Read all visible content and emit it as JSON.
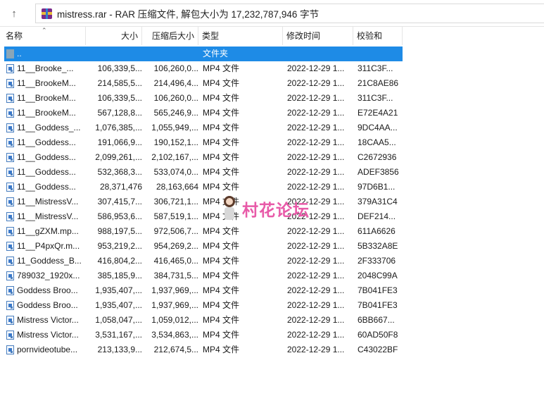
{
  "address_bar": {
    "path": "mistress.rar - RAR 压缩文件, 解包大小为 17,232,787,946 字节"
  },
  "columns": {
    "name": "名称",
    "size": "大小",
    "packed": "压缩后大小",
    "type": "类型",
    "modified": "修改时间",
    "crc": "校验和"
  },
  "parent_row": {
    "name": "..",
    "type": "文件夹"
  },
  "files": [
    {
      "name": "11__Brooke_...",
      "size": "106,339,5...",
      "packed": "106,260,0...",
      "type": "MP4 文件",
      "modified": "2022-12-29 1...",
      "crc": "311C3F..."
    },
    {
      "name": "11__BrookeM...",
      "size": "214,585,5...",
      "packed": "214,496,4...",
      "type": "MP4 文件",
      "modified": "2022-12-29 1...",
      "crc": "21C8AE86"
    },
    {
      "name": "11__BrookeM...",
      "size": "106,339,5...",
      "packed": "106,260,0...",
      "type": "MP4 文件",
      "modified": "2022-12-29 1...",
      "crc": "311C3F..."
    },
    {
      "name": "11__BrookeM...",
      "size": "567,128,8...",
      "packed": "565,246,9...",
      "type": "MP4 文件",
      "modified": "2022-12-29 1...",
      "crc": "E72E4A21"
    },
    {
      "name": "11__Goddess_...",
      "size": "1,076,385,...",
      "packed": "1,055,949,...",
      "type": "MP4 文件",
      "modified": "2022-12-29 1...",
      "crc": "9DC4AA..."
    },
    {
      "name": "11__Goddess...",
      "size": "191,066,9...",
      "packed": "190,152,1...",
      "type": "MP4 文件",
      "modified": "2022-12-29 1...",
      "crc": "18CAA5..."
    },
    {
      "name": "11__Goddess...",
      "size": "2,099,261,...",
      "packed": "2,102,167,...",
      "type": "MP4 文件",
      "modified": "2022-12-29 1...",
      "crc": "C2672936"
    },
    {
      "name": "11__Goddess...",
      "size": "532,368,3...",
      "packed": "533,074,0...",
      "type": "MP4 文件",
      "modified": "2022-12-29 1...",
      "crc": "ADEF3856"
    },
    {
      "name": "11__Goddess...",
      "size": "28,371,476",
      "packed": "28,163,664",
      "type": "MP4 文件",
      "modified": "2022-12-29 1...",
      "crc": "97D6B1..."
    },
    {
      "name": "11__MistressV...",
      "size": "307,415,7...",
      "packed": "306,721,1...",
      "type": "MP4 文件",
      "modified": "2022-12-29 1...",
      "crc": "379A31C4"
    },
    {
      "name": "11__MistressV...",
      "size": "586,953,6...",
      "packed": "587,519,1...",
      "type": "MP4 文件",
      "modified": "2022-12-29 1...",
      "crc": "DEF214..."
    },
    {
      "name": "11__gZXM.mp...",
      "size": "988,197,5...",
      "packed": "972,506,7...",
      "type": "MP4 文件",
      "modified": "2022-12-29 1...",
      "crc": "611A6626"
    },
    {
      "name": "11__P4pxQr.m...",
      "size": "953,219,2...",
      "packed": "954,269,2...",
      "type": "MP4 文件",
      "modified": "2022-12-29 1...",
      "crc": "5B332A8E"
    },
    {
      "name": "11_Goddess_B...",
      "size": "416,804,2...",
      "packed": "416,465,0...",
      "type": "MP4 文件",
      "modified": "2022-12-29 1...",
      "crc": "2F333706"
    },
    {
      "name": "789032_1920x...",
      "size": "385,185,9...",
      "packed": "384,731,5...",
      "type": "MP4 文件",
      "modified": "2022-12-29 1...",
      "crc": "2048C99A"
    },
    {
      "name": "Goddess Broo...",
      "size": "1,935,407,...",
      "packed": "1,937,969,...",
      "type": "MP4 文件",
      "modified": "2022-12-29 1...",
      "crc": "7B041FE3"
    },
    {
      "name": "Goddess Broo...",
      "size": "1,935,407,...",
      "packed": "1,937,969,...",
      "type": "MP4 文件",
      "modified": "2022-12-29 1...",
      "crc": "7B041FE3"
    },
    {
      "name": "Mistress Victor...",
      "size": "1,058,047,...",
      "packed": "1,059,012,...",
      "type": "MP4 文件",
      "modified": "2022-12-29 1...",
      "crc": "6BB667..."
    },
    {
      "name": "Mistress Victor...",
      "size": "3,531,167,...",
      "packed": "3,534,863,...",
      "type": "MP4 文件",
      "modified": "2022-12-29 1...",
      "crc": "60AD50F8"
    },
    {
      "name": "pornvideotube...",
      "size": "213,133,9...",
      "packed": "212,674,5...",
      "type": "MP4 文件",
      "modified": "2022-12-29 1...",
      "crc": "C43022BF"
    }
  ],
  "watermark": {
    "text": "村花论坛"
  },
  "colors": {
    "selection": "#1e8be6",
    "watermark": "#e85aa8"
  }
}
